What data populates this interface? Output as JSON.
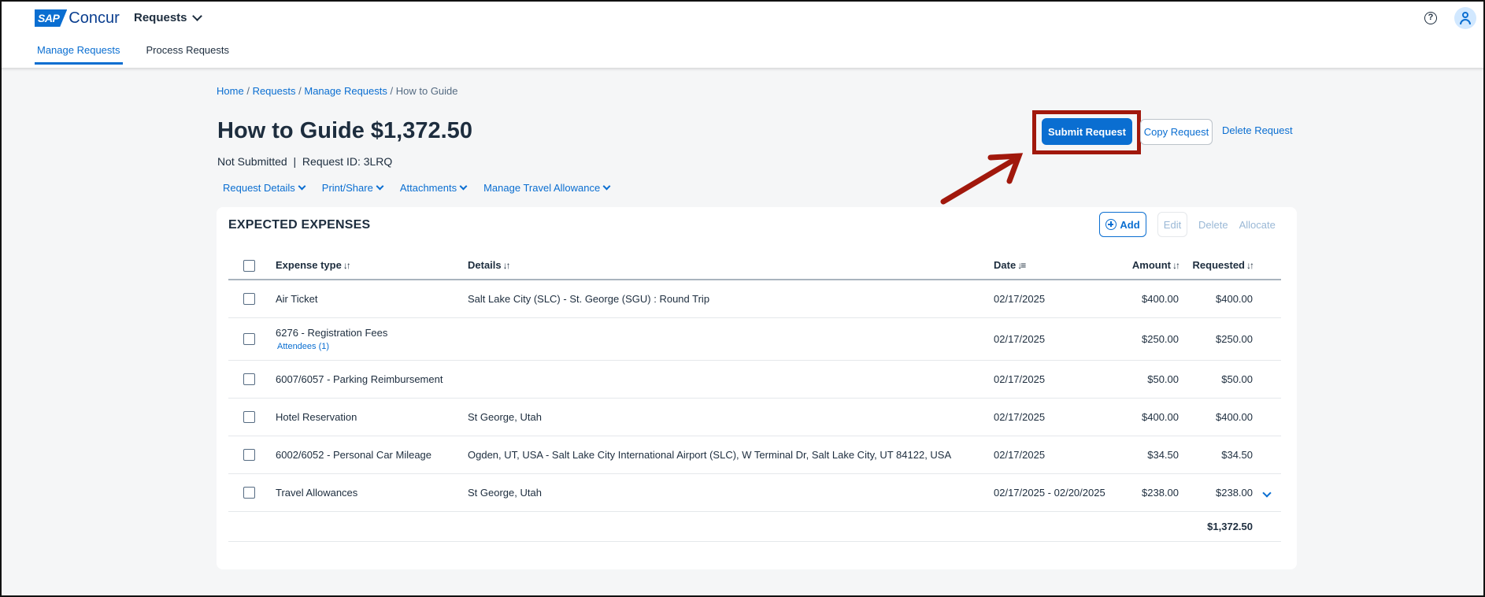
{
  "app": {
    "logo_badge": "SAP",
    "logo_text": "Concur",
    "menu_label": "Requests",
    "help_glyph": "?"
  },
  "tabs": [
    {
      "label": "Manage Requests",
      "active": true
    },
    {
      "label": "Process Requests",
      "active": false
    }
  ],
  "breadcrumb": {
    "home": "Home",
    "requests": "Requests",
    "manage": "Manage Requests",
    "current": "How to Guide",
    "sep": "/"
  },
  "page": {
    "title": "How to Guide $1,372.50",
    "status": "Not Submitted",
    "status_sep": "|",
    "request_id": "Request ID: 3LRQ"
  },
  "submenus": [
    {
      "label": "Request Details"
    },
    {
      "label": "Print/Share"
    },
    {
      "label": "Attachments"
    },
    {
      "label": "Manage Travel Allowance"
    }
  ],
  "actions": {
    "submit": "Submit Request",
    "copy": "Copy Request",
    "delete": "Delete Request"
  },
  "expenses": {
    "title": "EXPECTED EXPENSES",
    "add": "Add",
    "edit": "Edit",
    "delete": "Delete",
    "allocate": "Allocate",
    "columns": {
      "type": "Expense type",
      "details": "Details",
      "date": "Date",
      "amount": "Amount",
      "requested": "Requested"
    },
    "rows": [
      {
        "type": "Air Ticket",
        "sub": "",
        "details": "Salt Lake City (SLC) - St. George (SGU) : Round Trip",
        "date": "02/17/2025",
        "amount": "$400.00",
        "requested": "$400.00"
      },
      {
        "type": "6276 - Registration Fees",
        "sub": "Attendees (1)",
        "details": "",
        "date": "02/17/2025",
        "amount": "$250.00",
        "requested": "$250.00"
      },
      {
        "type": "6007/6057 - Parking Reimbursement",
        "sub": "",
        "details": "",
        "date": "02/17/2025",
        "amount": "$50.00",
        "requested": "$50.00"
      },
      {
        "type": "Hotel Reservation",
        "sub": "",
        "details": "St George, Utah",
        "date": "02/17/2025",
        "amount": "$400.00",
        "requested": "$400.00"
      },
      {
        "type": "6002/6052 - Personal Car Mileage",
        "sub": "",
        "details": "Ogden, UT, USA - Salt Lake City International Airport (SLC), W Terminal Dr, Salt Lake City, UT 84122, USA",
        "date": "02/17/2025",
        "amount": "$34.50",
        "requested": "$34.50"
      },
      {
        "type": "Travel Allowances",
        "sub": "",
        "details": "St George, Utah",
        "date": "02/17/2025 - 02/20/2025",
        "amount": "$238.00",
        "requested": "$238.00"
      }
    ],
    "total": "$1,372.50"
  },
  "colors": {
    "accent": "#0a6ed1",
    "highlight": "#a1180c"
  }
}
